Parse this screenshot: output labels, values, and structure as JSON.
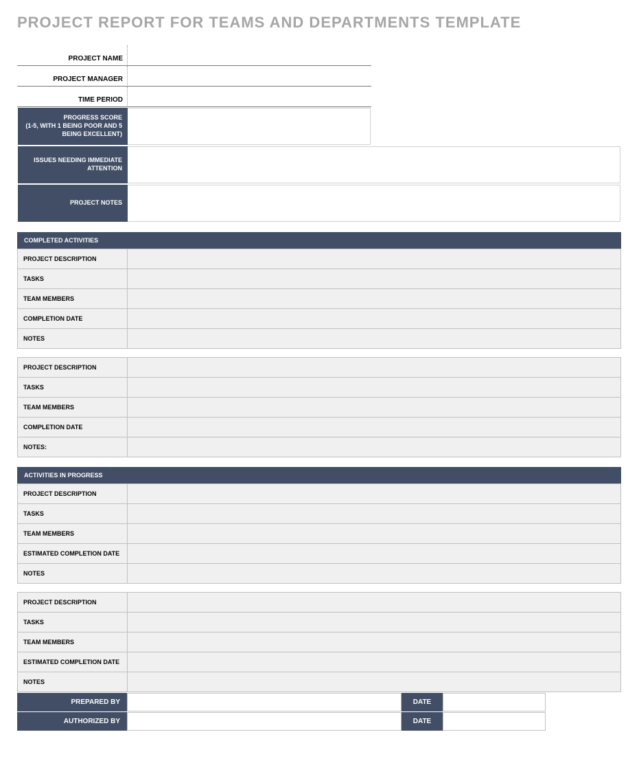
{
  "title": "PROJECT REPORT FOR TEAMS AND DEPARTMENTS TEMPLATE",
  "header": {
    "project_name": "PROJECT NAME",
    "project_manager": "PROJECT MANAGER",
    "time_period": "TIME PERIOD",
    "progress_score": "PROGRESS SCORE\n(1-5, WITH 1 BEING POOR AND 5 BEING EXCELLENT)",
    "issues": "ISSUES NEEDING IMMEDIATE ATTENTION",
    "notes": "PROJECT NOTES"
  },
  "sections": {
    "completed": {
      "heading": "COMPLETED ACTIVITIES",
      "blocks": [
        {
          "desc": "PROJECT DESCRIPTION",
          "tasks": "TASKS",
          "team": "TEAM MEMBERS",
          "date": "COMPLETION DATE",
          "notes": "NOTES"
        },
        {
          "desc": "PROJECT DESCRIPTION",
          "tasks": "TASKS",
          "team": "TEAM MEMBERS",
          "date": "COMPLETION DATE",
          "notes": "NOTES:"
        }
      ]
    },
    "in_progress": {
      "heading": "ACTIVITIES IN PROGRESS",
      "blocks": [
        {
          "desc": "PROJECT DESCRIPTION",
          "tasks": "TASKS",
          "team": "TEAM MEMBERS",
          "date": "ESTIMATED COMPLETION DATE",
          "notes": "NOTES"
        },
        {
          "desc": "PROJECT DESCRIPTION",
          "tasks": "TASKS",
          "team": "TEAM MEMBERS",
          "date": "ESTIMATED COMPLETION DATE",
          "notes": "NOTES"
        }
      ]
    }
  },
  "footer": {
    "prepared_by": "PREPARED BY",
    "authorized_by": "AUTHORIZED BY",
    "date": "DATE"
  }
}
